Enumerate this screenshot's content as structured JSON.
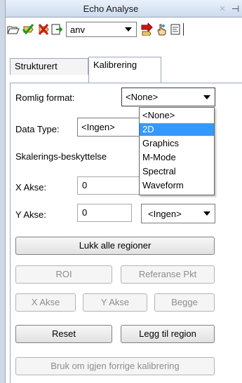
{
  "window": {
    "title": "Echo Analyse",
    "close_glyph": "×",
    "pin_glyph": "⊣"
  },
  "toolbar": {
    "combo_value": "anv",
    "icons": [
      "open-folder-icon",
      "green-check-tag-icon",
      "red-x-tag-icon",
      "export-icon",
      "red-arrow-icon",
      "hand-pointer-icon",
      "document-icon"
    ]
  },
  "tabs": [
    {
      "label": "Strukturert",
      "active": false
    },
    {
      "label": "Kalibrering",
      "active": true
    }
  ],
  "form": {
    "romlig_label": "Romlig format:",
    "romlig_value": "<None>",
    "datatype_label": "Data Type:",
    "datatype_value": "<Ingen>",
    "skalering_label": "Skalerings-beskyttelse",
    "xakse_label": "X Akse:",
    "xakse_value": "0",
    "yakse_label": "Y Akse:",
    "yakse_value": "0",
    "yakse_unit": "<Ingen>"
  },
  "dropdown": {
    "options": [
      "<None>",
      "2D",
      "Graphics",
      "M-Mode",
      "Spectral",
      "Waveform"
    ],
    "selected_index": 1
  },
  "buttons": {
    "lukk": "Lukk alle regioner",
    "roi": "ROI",
    "referanse": "Referanse Pkt",
    "xakse": "X Akse",
    "yakse": "Y Akse",
    "begge": "Begge",
    "reset": "Reset",
    "legg_til": "Legg til region",
    "bruk_om_igjen": "Bruk om igjen forrige kalibrering"
  },
  "colors": {
    "selection": "#3399ff",
    "title_bar": "#cddbef",
    "disabled_text": "#8d8d8d"
  }
}
